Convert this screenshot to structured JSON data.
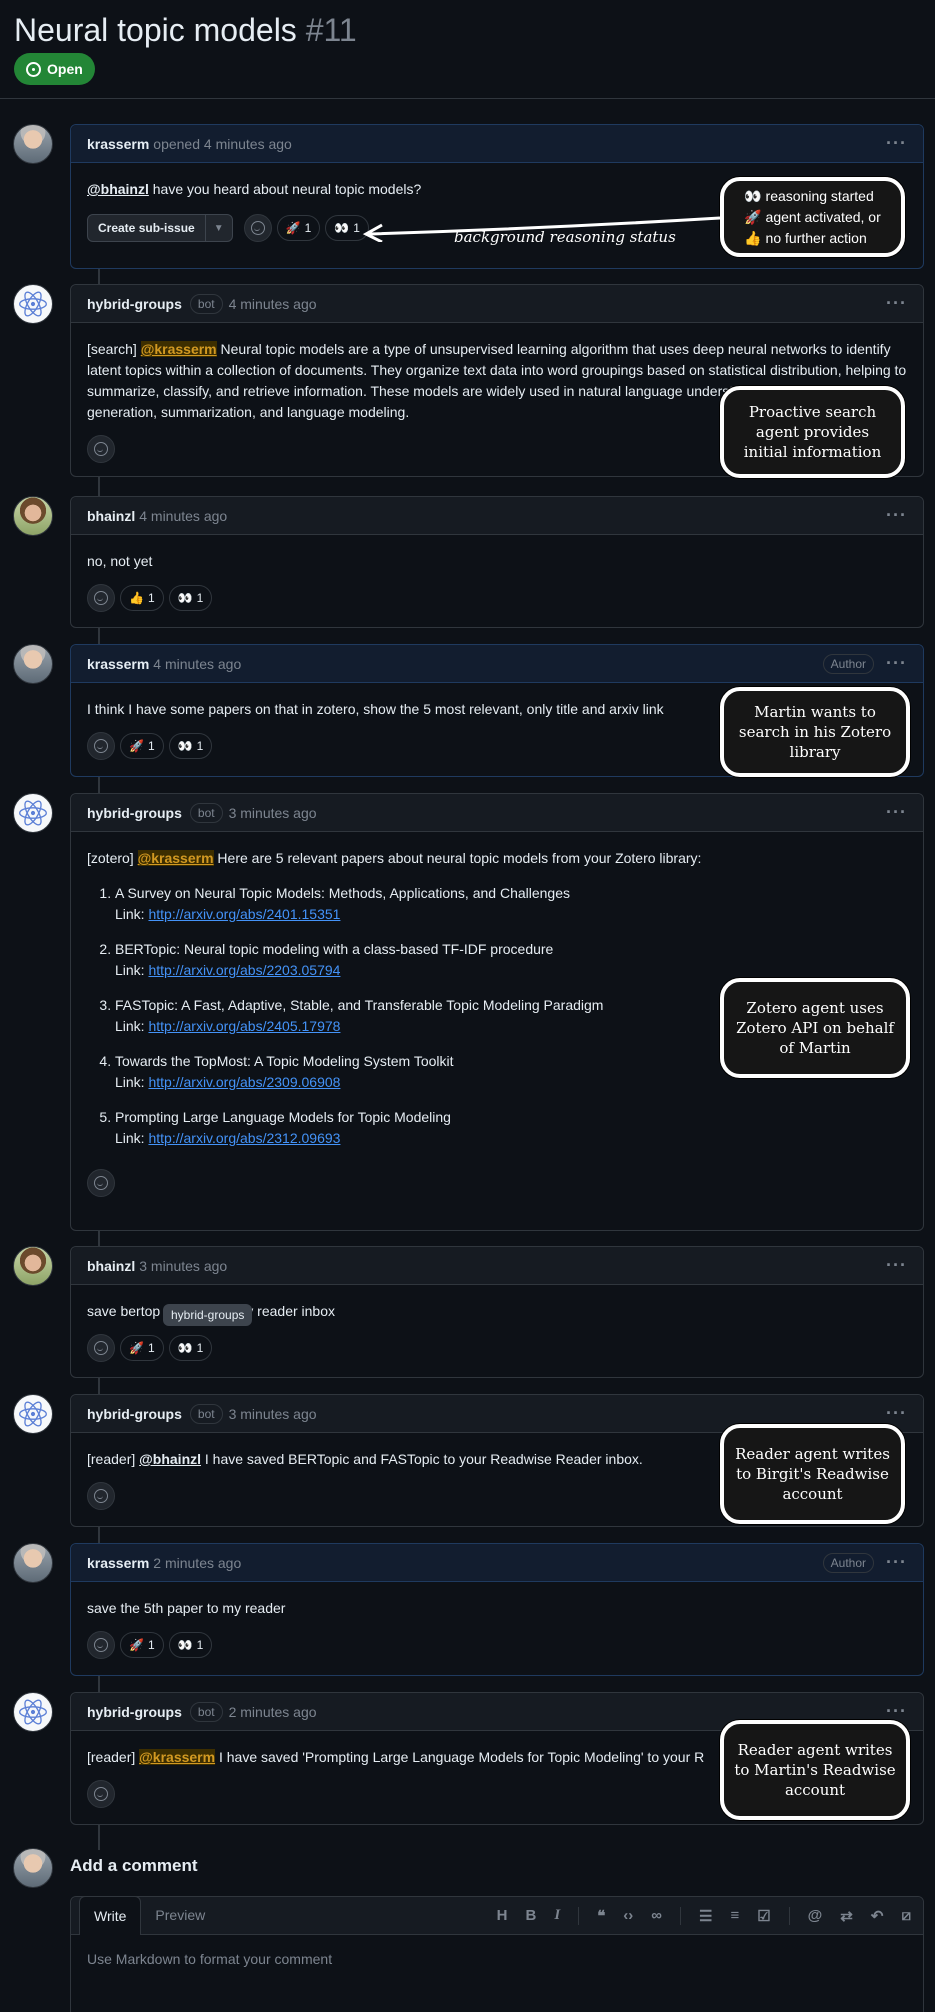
{
  "issue": {
    "title": "Neural topic models",
    "number": "#11",
    "state": "Open"
  },
  "comments": [
    {
      "author": "krasserm",
      "verb": "opened",
      "time": "4 minutes ago",
      "text_mention": "@bhainzl",
      "text": " have you heard about neural topic models?",
      "sub_issue_label": "Create sub-issue",
      "reactions": [
        {
          "emoji": "🚀",
          "count": "1"
        },
        {
          "emoji": "👀",
          "count": "1"
        }
      ]
    },
    {
      "author": "hybrid-groups",
      "badge": "bot",
      "time": "4 minutes ago",
      "prefix": "[search] ",
      "mention": "@krasserm",
      "text": " Neural topic models are a type of unsupervised learning algorithm that uses deep neural networks to identify latent topics within a collection of documents. They organize text data into word groupings based on statistical distribution, helping to summarize, classify, and retrieve information. These models are widely used in natural language understanding for tasks like text generation, summarization, and language modeling."
    },
    {
      "author": "bhainzl",
      "time": "4 minutes ago",
      "text": "no, not yet",
      "reactions": [
        {
          "emoji": "👍",
          "count": "1"
        },
        {
          "emoji": "👀",
          "count": "1"
        }
      ]
    },
    {
      "author": "krasserm",
      "time": "4 minutes ago",
      "badge": "Author",
      "text": "I think I have some papers on that in zotero, show the 5 most relevant, only title and arxiv link",
      "reactions": [
        {
          "emoji": "🚀",
          "count": "1"
        },
        {
          "emoji": "👀",
          "count": "1"
        }
      ]
    },
    {
      "author": "hybrid-groups",
      "badge": "bot",
      "time": "3 minutes ago",
      "prefix": "[zotero] ",
      "mention": "@krasserm",
      "text": " Here are 5 relevant papers about neural topic models from your Zotero library:",
      "link_label": "Link: ",
      "papers": [
        {
          "title": "A Survey on Neural Topic Models: Methods, Applications, and Challenges",
          "url": "http://arxiv.org/abs/2401.15351"
        },
        {
          "title": "BERTopic: Neural topic modeling with a class-based TF-IDF procedure",
          "url": "http://arxiv.org/abs/2203.05794"
        },
        {
          "title": "FASTopic: A Fast, Adaptive, Stable, and Transferable Topic Modeling Paradigm",
          "url": "http://arxiv.org/abs/2405.17978"
        },
        {
          "title": "Towards the TopMost: A Topic Modeling System Toolkit",
          "url": "http://arxiv.org/abs/2309.06908"
        },
        {
          "title": "Prompting Large Language Models for Topic Modeling",
          "url": "http://arxiv.org/abs/2312.09693"
        }
      ]
    },
    {
      "author": "bhainzl",
      "time": "3 minutes ago",
      "text_a": "save bertop",
      "text_b": "c to my reader inbox",
      "tooltip": "hybrid-groups",
      "reactions": [
        {
          "emoji": "🚀",
          "count": "1"
        },
        {
          "emoji": "👀",
          "count": "1"
        }
      ]
    },
    {
      "author": "hybrid-groups",
      "badge": "bot",
      "time": "3 minutes ago",
      "prefix": "[reader] ",
      "mention": "@bhainzl",
      "text": " I have saved BERTopic and FASTopic to your Readwise Reader inbox."
    },
    {
      "author": "krasserm",
      "time": "2 minutes ago",
      "badge": "Author",
      "text": "save the 5th paper to my reader",
      "reactions": [
        {
          "emoji": "🚀",
          "count": "1"
        },
        {
          "emoji": "👀",
          "count": "1"
        }
      ]
    },
    {
      "author": "hybrid-groups",
      "badge": "bot",
      "time": "2 minutes ago",
      "prefix": "[reader] ",
      "mention": "@krasserm",
      "text": " I have saved 'Prompting Large Language Models for Topic Modeling' to your R"
    }
  ],
  "notes": {
    "status": [
      "👀 reasoning started",
      "🚀 agent activated, or",
      "👍 no further action"
    ],
    "arrow_label": "background reasoning status",
    "search": "Proactive search agent provides initial information",
    "zotero_wants": "Martin wants to search in his Zotero library",
    "zotero_agent": "Zotero agent uses Zotero API on behalf of Martin",
    "reader_birgit": "Reader agent writes to Birgit's Readwise account",
    "reader_martin": "Reader agent writes to Martin's Readwise account"
  },
  "add_comment": {
    "title": "Add a comment",
    "tab_write": "Write",
    "tab_preview": "Preview",
    "placeholder": "Use Markdown to format your comment",
    "toolbar": [
      "H",
      "B",
      "I",
      "quote",
      "code",
      "link",
      "bullets",
      "numbers",
      "tasks",
      "mention",
      "reference",
      "reply",
      "slash"
    ]
  },
  "colors": {
    "accent": "#4493f8",
    "open": "#238636",
    "mention_hl": "#d29922"
  }
}
